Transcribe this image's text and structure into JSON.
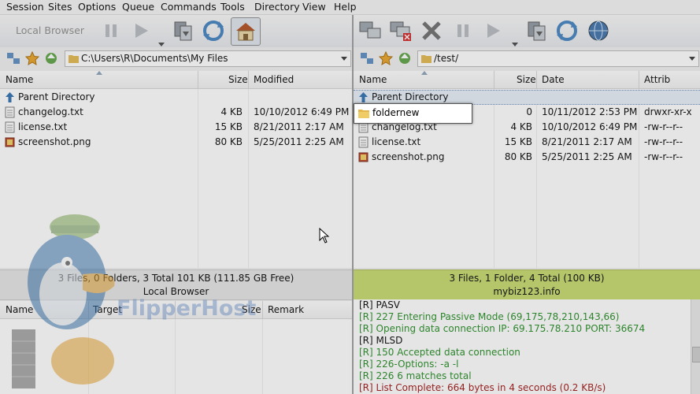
{
  "menu": [
    "Session",
    "Sites",
    "Options",
    "Queue",
    "Commands",
    "Tools",
    "Directory",
    "View",
    "Help"
  ],
  "local": {
    "toolbar_label": "Local Browser",
    "path": "C:\\Users\\R\\Documents\\My Files",
    "columns": {
      "name": "Name",
      "size": "Size",
      "modified": "Modified"
    },
    "parent": "Parent Directory",
    "files": [
      {
        "name": "changelog.txt",
        "size": "4 KB",
        "modified": "10/10/2012 6:49 PM",
        "icon": "text-file-icon"
      },
      {
        "name": "license.txt",
        "size": "15 KB",
        "modified": "8/21/2011 2:17 AM",
        "icon": "text-file-icon"
      },
      {
        "name": "screenshot.png",
        "size": "80 KB",
        "modified": "5/25/2011 2:25 AM",
        "icon": "image-file-icon"
      }
    ],
    "status_summary": "3 Files, 0 Folders, 3 Total 101 KB (111.85 GB Free)",
    "status_name": "Local Browser"
  },
  "remote": {
    "path": "/test/",
    "columns": {
      "name": "Name",
      "size": "Size",
      "date": "Date",
      "attrib": "Attrib"
    },
    "parent": "Parent Directory",
    "edit_value": "foldernew",
    "files": [
      {
        "name": "",
        "size": "0",
        "date": "10/11/2012 2:53 PM",
        "attrib": "drwxr-xr-x",
        "icon": "folder-icon"
      },
      {
        "name": "changelog.txt",
        "size": "4 KB",
        "date": "10/10/2012 6:49 PM",
        "attrib": "-rw-r--r--",
        "icon": "text-file-icon"
      },
      {
        "name": "license.txt",
        "size": "15 KB",
        "date": "8/21/2011 2:17 AM",
        "attrib": "-rw-r--r--",
        "icon": "text-file-icon"
      },
      {
        "name": "screenshot.png",
        "size": "80 KB",
        "date": "5/25/2011 2:25 AM",
        "attrib": "-rw-r--r--",
        "icon": "image-file-icon"
      }
    ],
    "status_summary": "3 Files, 1 Folder, 4 Total (100 KB)",
    "status_name": "mybiz123.info"
  },
  "queue": {
    "columns": {
      "name": "Name",
      "target": "Target",
      "size": "Size",
      "remark": "Remark"
    }
  },
  "watermark": "FlipperHost",
  "log": [
    {
      "text": "[R] PASV",
      "kind": "cmd"
    },
    {
      "text": "[R] 227 Entering Passive Mode (69,175,78,210,143,66)",
      "kind": "resp"
    },
    {
      "text": "[R] Opening data connection IP: 69.175.78.210 PORT: 36674",
      "kind": "resp"
    },
    {
      "text": "[R] MLSD",
      "kind": "cmd"
    },
    {
      "text": "[R] 150 Accepted data connection",
      "kind": "resp"
    },
    {
      "text": "[R] 226-Options: -a -l",
      "kind": "resp"
    },
    {
      "text": "[R] 226 6 matches total",
      "kind": "resp"
    },
    {
      "text": "[R] List Complete: 664 bytes in 4 seconds (0.2 KB/s)",
      "kind": "done"
    }
  ],
  "colors": {
    "remote_status": "#c5d96a",
    "local_status": "#e4e4e4",
    "log_resp": "#1f8a1f",
    "log_done": "#a01010"
  }
}
